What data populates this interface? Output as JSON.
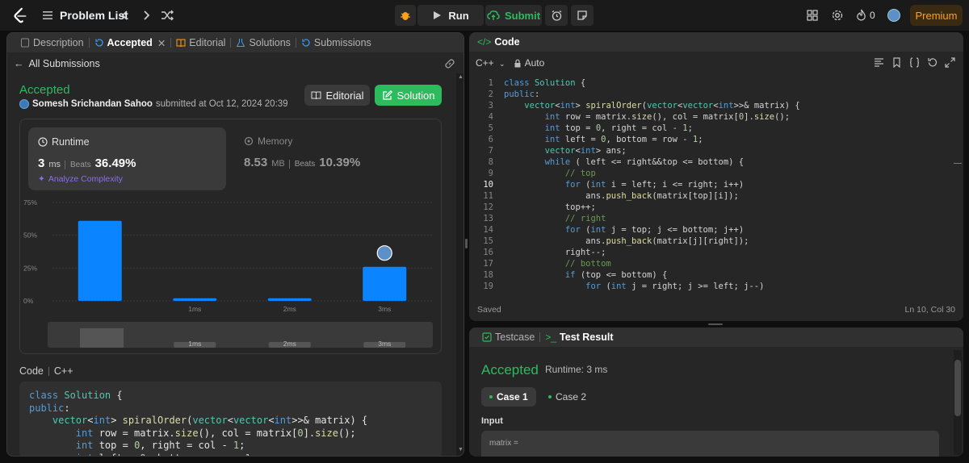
{
  "topbar": {
    "problem_list": "Problem List",
    "run": "Run",
    "submit": "Submit",
    "streak": "0",
    "premium": "Premium"
  },
  "left_tabs": [
    {
      "label": "Description"
    },
    {
      "label": "Accepted"
    },
    {
      "label": "Editorial"
    },
    {
      "label": "Solutions"
    },
    {
      "label": "Submissions"
    }
  ],
  "submission": {
    "back": "All Submissions",
    "status": "Accepted",
    "user": "Somesh Srichandan Sahoo",
    "submitted_at": "submitted at Oct 12, 2024 20:39",
    "editorial_btn": "Editorial",
    "solution_btn": "Solution",
    "runtime_label": "Runtime",
    "runtime_value": "3",
    "runtime_unit": "ms",
    "beats_label": "Beats",
    "runtime_beats": "36.49%",
    "analyze": "Analyze Complexity",
    "memory_label": "Memory",
    "memory_value": "8.53",
    "memory_unit": "MB",
    "memory_beats": "10.39%",
    "code_label": "Code",
    "code_lang": "C++"
  },
  "chart_data": {
    "type": "bar",
    "categories": [
      "",
      "1ms",
      "2ms",
      "3ms"
    ],
    "values": [
      61,
      2,
      2,
      26
    ],
    "ylim": [
      0,
      75
    ],
    "yticks": [
      "0%",
      "25%",
      "50%",
      "75%"
    ],
    "color": "#0a84ff",
    "grid": true,
    "highlight_category": "3ms"
  },
  "mini_chart_labels": [
    "1ms",
    "2ms",
    "3ms"
  ],
  "code_panel": {
    "title": "Code",
    "lang": "C++",
    "mode": "Auto",
    "saved": "Saved",
    "cursor": "Ln 10, Col 30"
  },
  "code_lines": [
    "class Solution {",
    "public:",
    "    vector<int> spiralOrder(vector<vector<int>>& matrix) {",
    "        int row = matrix.size(), col = matrix[0].size();",
    "        int top = 0, right = col - 1;",
    "        int left = 0, bottom = row - 1;",
    "        vector<int> ans;",
    "        while ( left <= right&&top <= bottom) {",
    "            // top",
    "            for (int i = left; i <= right; i++)",
    "                ans.push_back(matrix[top][i]);",
    "            top++;",
    "            // right",
    "            for (int j = top; j <= bottom; j++)",
    "                ans.push_back(matrix[j][right]);",
    "            right--;",
    "            // bottom",
    "            if (top <= bottom) {",
    "                for (int j = right; j >= left; j--)"
  ],
  "line_numbers": [
    "1",
    "2",
    "3",
    "4",
    "5",
    "6",
    "7",
    "8",
    "9",
    "10",
    "11",
    "12",
    "13",
    "14",
    "15",
    "16",
    "17",
    "18",
    "19"
  ],
  "left_code_lines": [
    "class Solution {",
    "public:",
    "    vector<int> spiralOrder(vector<vector<int>>& matrix) {",
    "        int row = matrix.size(), col = matrix[0].size();",
    "        int top = 0, right = col - 1;",
    "        int left = 0, bottom = row - 1;"
  ],
  "result": {
    "tab_testcase": "Testcase",
    "tab_result": "Test Result",
    "status": "Accepted",
    "runtime": "Runtime: 3 ms",
    "case1": "Case 1",
    "case2": "Case 2",
    "input_label": "Input",
    "matrix_label": "matrix ="
  }
}
